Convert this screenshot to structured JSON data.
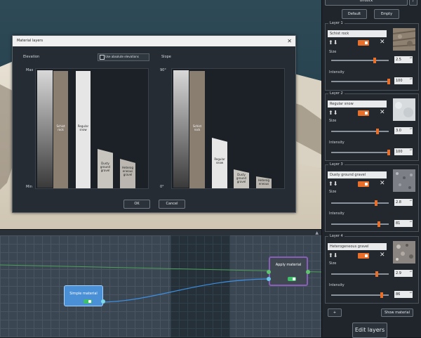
{
  "top_panel": {
    "undock_label": "Undock",
    "slash_label": "/",
    "default_label": "Default",
    "empty_label": "Empty"
  },
  "layers": [
    {
      "title": "Layer 1",
      "name": "Schist rock",
      "size_label": "Size",
      "size": "2.5",
      "size_level": 0.72,
      "intensity_label": "Intensity",
      "intensity": "100",
      "intensity_level": 1.0,
      "texture": "schist-rock-texture"
    },
    {
      "title": "Layer 2",
      "name": "Regular snow",
      "size_label": "Size",
      "size": "3.0",
      "size_level": 0.78,
      "intensity_label": "Intensity",
      "intensity": "100",
      "intensity_level": 1.0,
      "texture": "snow-texture"
    },
    {
      "title": "Layer 3",
      "name": "Dusty ground gravel",
      "size_label": "Size",
      "size": "2.8",
      "size_level": 0.76,
      "intensity_label": "Intensity",
      "intensity": "81",
      "intensity_level": 0.81,
      "texture": "gravel-texture"
    },
    {
      "title": "Layer 4",
      "name": "Heterogeneous gravel",
      "size_label": "Size",
      "size": "2.9",
      "size_level": 0.77,
      "intensity_label": "Intensity",
      "intensity": "86",
      "intensity_level": 0.86,
      "texture": "heterogeneous-gravel-texture"
    }
  ],
  "panel_bottom": {
    "plus_label": "+",
    "show_material_label": "Show material",
    "edit_layers_label": "Edit layers"
  },
  "dialog": {
    "title": "Material layers",
    "elevation_label": "Elevation",
    "checkbox_label": "Use absolute elevations",
    "slope_label": "Slope",
    "elevation_axis": {
      "max": "Max",
      "min": "Min"
    },
    "slope_axis": {
      "max": "90°",
      "min": "0°"
    },
    "elevation_columns": [
      {
        "label": "Schist\nrock",
        "height": 1.0
      },
      {
        "label": "Regular\nsnow",
        "height": 1.0
      },
      {
        "label": "Dusty\nground\ngravel",
        "height": 0.33
      },
      {
        "label": "Heterog\neneous\ngravel",
        "height": 0.25
      }
    ],
    "slope_columns": [
      {
        "label": "Schist\nrock",
        "height": 1.0
      },
      {
        "label": "Regular\nsnow",
        "height": 0.43
      },
      {
        "label": "Dusty\nground\ngravel",
        "height": 0.15
      },
      {
        "label": "Heterog\neneous",
        "height": 0.1
      }
    ],
    "ok_label": "OK",
    "cancel_label": "Cancel",
    "close_glyph": "✕"
  },
  "graph": {
    "simple_node_label": "Simple material",
    "apply_node_label": "Apply material"
  },
  "colors": {
    "accent_orange": "#e8702a",
    "node_blue": "#4a90d6",
    "node_purple_border": "#8a5db8",
    "toggle_green": "#3fbf6a"
  }
}
